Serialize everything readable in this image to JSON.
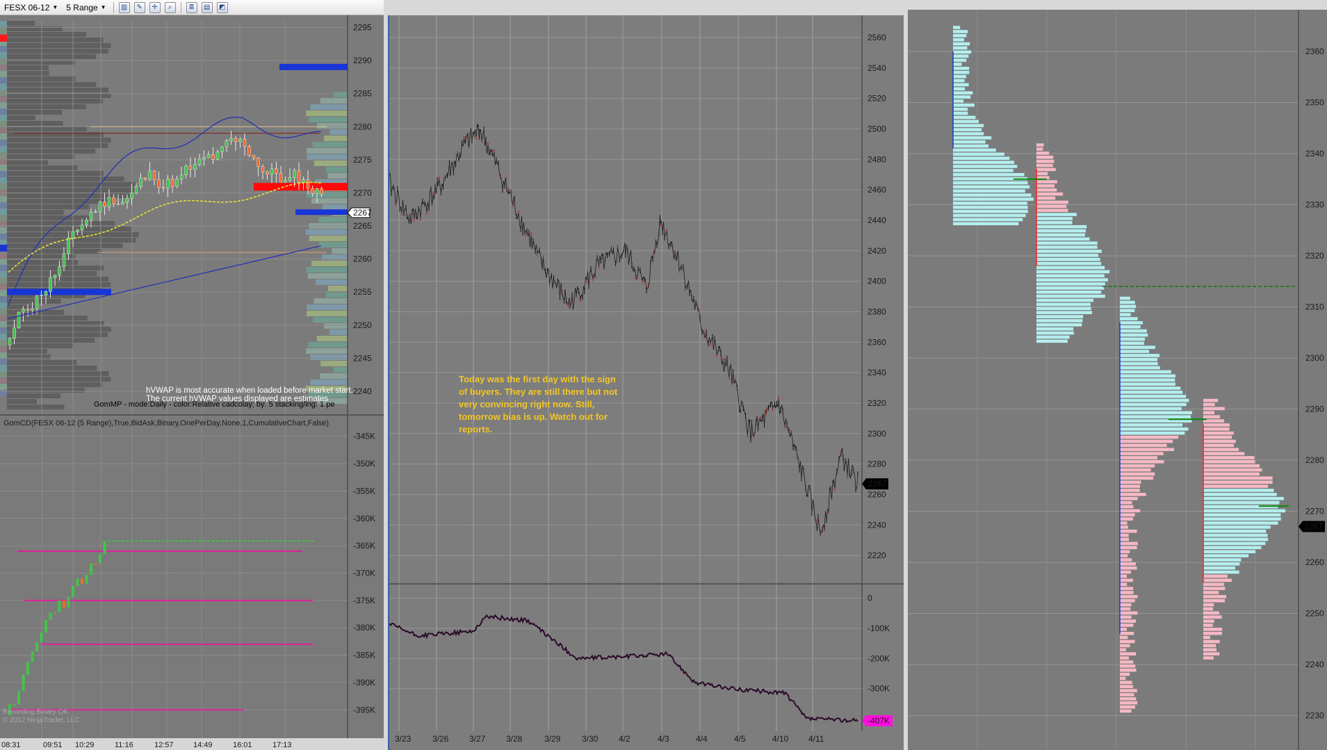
{
  "toolbar": {
    "instrument": "FESX 06-12",
    "interval": "5 Range",
    "icons": [
      "bar-chart-icon",
      "pencil-icon",
      "crosshair-icon",
      "zoom-icon",
      "properties-icon",
      "data-box-icon",
      "indicator-icon"
    ]
  },
  "left_panel": {
    "price_axis": [
      "2295",
      "2290",
      "2285",
      "2280",
      "2275",
      "2270",
      "2265",
      "2260",
      "2255",
      "2250",
      "2245",
      "2240"
    ],
    "last_price": "2267",
    "hvwap_message": "hVWAP is most accurate when loaded before market start.",
    "hvwap_message2": "The current hVWAP values displayed are estimates",
    "gommp_label": "GomMP - mode:Daily - color:Relative cadcolay; by: 5 stacking/ing: 1 pe",
    "indicator_label": "GomCD(FESX 06-12 (5 Range),True,BidAsk,Binary,OnePerDay,None,1,CumulativeChart,False)",
    "indicator_axis": [
      "-345K",
      "-350K",
      "-355K",
      "-360K",
      "-365K",
      "-370K",
      "-375K",
      "-380K",
      "-385K",
      "-390K",
      "-395K"
    ],
    "time_axis": [
      "08:31",
      "09:51",
      "10:29",
      "11:16",
      "12:57",
      "14:49",
      "16:01",
      "17:13"
    ],
    "watermark1": "Recording Binary OK",
    "watermark2": "© 2012 NinjaTrader, LLC"
  },
  "mid_panel": {
    "price_axis": [
      "2560",
      "2540",
      "2520",
      "2500",
      "2480",
      "2460",
      "2440",
      "2420",
      "2400",
      "2380",
      "2360",
      "2340",
      "2320",
      "2300",
      "2280",
      "2260",
      "2240",
      "2220"
    ],
    "last_price": "2267",
    "indicator_axis": [
      "0",
      "-100K",
      "-200K",
      "-300K"
    ],
    "indicator_last": "-407K",
    "date_axis": [
      "3/23",
      "3/26",
      "3/27",
      "3/28",
      "3/29",
      "3/30",
      "4/2",
      "4/3",
      "4/4",
      "4/5",
      "4/10",
      "4/11"
    ],
    "note": "Today was the first day with the sign of buyers. They are still there but not very convincing right now. Still, tomorrow bias is up.  Watch out for reports."
  },
  "right_panel": {
    "price_axis": [
      "2360",
      "2350",
      "2340",
      "2330",
      "2320",
      "2310",
      "2300",
      "2290",
      "2280",
      "2270",
      "2260",
      "2250",
      "2240",
      "2230"
    ],
    "last_price": "2267"
  },
  "colors": {
    "background": "#7e7e7e",
    "up_candle": "#44c24a",
    "down_candle": "#f06a2a",
    "vwap_blue": "#1d2fb8",
    "vwap_yellow": "#e6e23a",
    "profile_cyan": "#b4eeee",
    "profile_pink": "#f5b9c4",
    "magenta_level": "#e0229a",
    "note_text": "#f3c623"
  }
}
